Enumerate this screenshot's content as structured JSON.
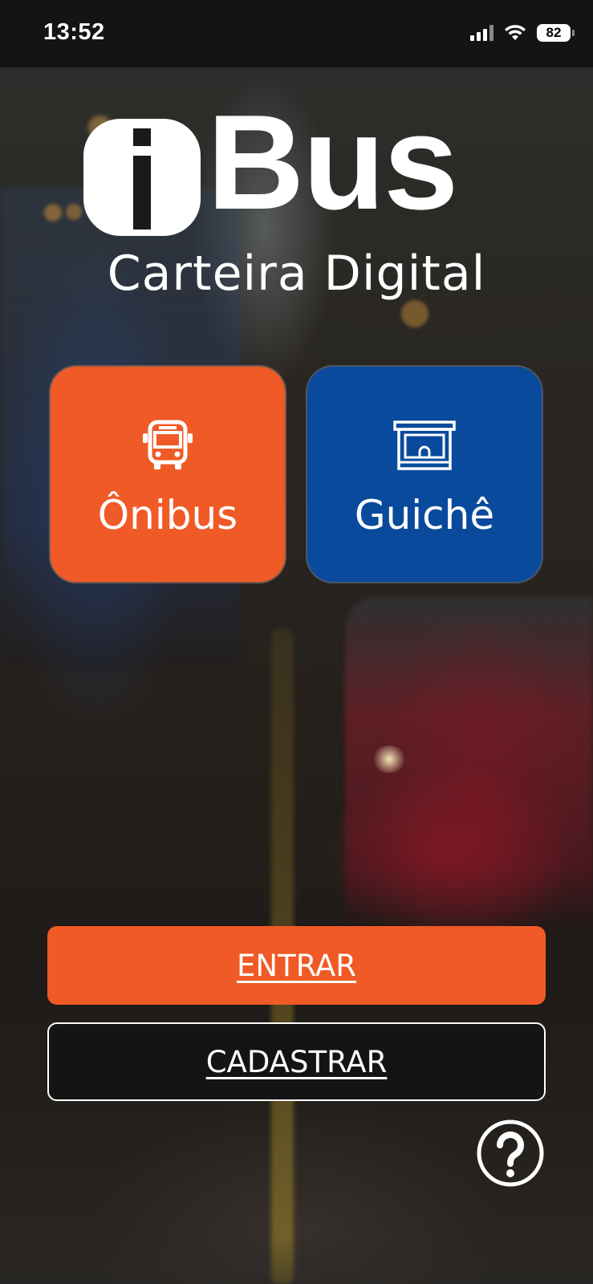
{
  "status_bar": {
    "time": "13:52",
    "battery_level": "82",
    "icons": [
      "signal-icon",
      "wifi-icon",
      "battery-icon"
    ]
  },
  "logo": {
    "i_letter": "i",
    "brand_text": "Bus",
    "subtitle": "Carteira Digital"
  },
  "modes": [
    {
      "label": "Ônibus",
      "icon": "bus-icon",
      "color": "#f05a26"
    },
    {
      "label": "Guichê",
      "icon": "ticket-booth-icon",
      "color": "#0a4a9c"
    }
  ],
  "actions": {
    "login_label": "ENTRAR",
    "register_label": "CADASTRAR"
  },
  "help": {
    "icon": "help-icon"
  },
  "colors": {
    "accent": "#f05a26",
    "secondary": "#0a4a9c",
    "text": "#ffffff"
  }
}
